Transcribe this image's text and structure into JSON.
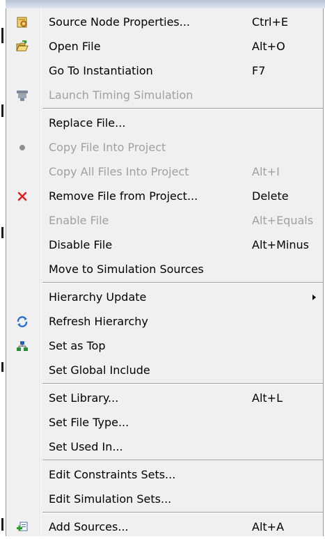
{
  "menu": {
    "items": {
      "source_node_properties": {
        "label": "Source Node Properties...",
        "shortcut": "Ctrl+E",
        "icon": "properties-icon"
      },
      "open_file": {
        "label": "Open File",
        "shortcut": "Alt+O",
        "icon": "open-file-icon"
      },
      "go_to_instantiation": {
        "label": "Go To Instantiation",
        "shortcut": "F7"
      },
      "launch_timing_simulation": {
        "label": "Launch Timing Simulation",
        "icon": "simulation-icon",
        "disabled": true
      },
      "replace_file": {
        "label": "Replace File..."
      },
      "copy_file_into_project": {
        "label": "Copy File Into Project",
        "icon": "dot-icon",
        "disabled": true
      },
      "copy_all_files_into_project": {
        "label": "Copy All Files Into Project",
        "shortcut": "Alt+I",
        "disabled": true
      },
      "remove_file_from_project": {
        "label": "Remove File from Project...",
        "shortcut": "Delete",
        "icon": "remove-x-icon"
      },
      "enable_file": {
        "label": "Enable File",
        "shortcut": "Alt+Equals",
        "disabled": true
      },
      "disable_file": {
        "label": "Disable File",
        "shortcut": "Alt+Minus"
      },
      "move_to_simulation_sources": {
        "label": "Move to Simulation Sources"
      },
      "hierarchy_update": {
        "label": "Hierarchy Update",
        "has_submenu": true
      },
      "refresh_hierarchy": {
        "label": "Refresh Hierarchy",
        "icon": "refresh-icon"
      },
      "set_as_top": {
        "label": "Set as Top",
        "icon": "hierarchy-icon"
      },
      "set_global_include": {
        "label": "Set Global Include"
      },
      "set_library": {
        "label": "Set Library...",
        "shortcut": "Alt+L"
      },
      "set_file_type": {
        "label": "Set File Type..."
      },
      "set_used_in": {
        "label": "Set Used In..."
      },
      "edit_constraints_sets": {
        "label": "Edit Constraints Sets..."
      },
      "edit_simulation_sets": {
        "label": "Edit Simulation Sets..."
      },
      "add_sources": {
        "label": "Add Sources...",
        "shortcut": "Alt+A",
        "icon": "add-sources-icon"
      }
    }
  },
  "colors": {
    "menu_background": "#f0f0f0",
    "text": "#000000",
    "disabled_text": "#a0a0a0",
    "remove_icon": "#e02020"
  }
}
